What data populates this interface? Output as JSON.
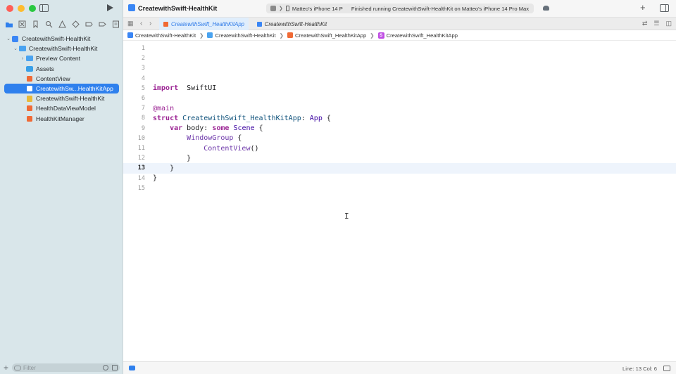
{
  "window": {
    "project_title": "CreatewithSwift-HealthKit",
    "scheme": {
      "device": "Matteo's iPhone 14 P",
      "status": "Finished running CreatewithSwift-HealthKit on Matteo's iPhone 14 Pro Max"
    },
    "add_label": "+"
  },
  "sidebar": {
    "traffic_colors": [
      "#ff5f57",
      "#febc2e",
      "#28c840"
    ],
    "nav_icons": [
      "folder-icon",
      "source-control-icon",
      "bookmark-icon",
      "find-icon",
      "issue-icon",
      "test-icon",
      "debug-icon",
      "breakpoint-icon",
      "report-icon"
    ],
    "tree": [
      {
        "label": "CreatewithSwift-HealthKit",
        "icon": "xcode-project-icon",
        "indent": 0,
        "chevron": "v"
      },
      {
        "label": "CreatewithSwift-HealthKit",
        "icon": "folder-icon",
        "indent": 1,
        "chevron": "v"
      },
      {
        "label": "Preview Content",
        "icon": "folder-icon",
        "indent": 2,
        "chevron": ">"
      },
      {
        "label": "Assets",
        "icon": "asset-catalog-icon",
        "indent": 2,
        "chevron": ""
      },
      {
        "label": "ContentView",
        "icon": "swift-file-icon",
        "indent": 2,
        "chevron": ""
      },
      {
        "label": "CreatewithSw...HealthKitApp",
        "icon": "swift-file-icon",
        "indent": 2,
        "chevron": "",
        "selected": true
      },
      {
        "label": "CreatewithSwift-HealthKit",
        "icon": "entitlements-icon",
        "indent": 2,
        "chevron": ""
      },
      {
        "label": "HealthDataViewModel",
        "icon": "swift-file-icon",
        "indent": 2,
        "chevron": ""
      },
      {
        "label": "HealthKitManager",
        "icon": "swift-file-icon",
        "indent": 2,
        "chevron": ""
      }
    ],
    "filter_placeholder": "Filter",
    "add_label": "+"
  },
  "tabs": [
    {
      "label": "CreatewithSwift_HealthKitApp",
      "active": true
    },
    {
      "label": "CreatewithSwift-HealthKit",
      "active": false
    }
  ],
  "breadcrumb": [
    "CreatewithSwift-HealthKit",
    "CreatewithSwift-HealthKit",
    "CreatewithSwift_HealthKitApp",
    "CreatewithSwift_HealthKitApp"
  ],
  "breadcrumb_badge": "S",
  "editor": {
    "current_line": 13,
    "lines": [
      {
        "n": "1",
        "tokens": []
      },
      {
        "n": "2",
        "tokens": []
      },
      {
        "n": "3",
        "tokens": []
      },
      {
        "n": "4",
        "tokens": []
      },
      {
        "n": "5",
        "tokens": [
          [
            "kw",
            "import"
          ],
          [
            "",
            "  SwiftUI"
          ]
        ]
      },
      {
        "n": "6",
        "tokens": []
      },
      {
        "n": "7",
        "tokens": [
          [
            "attr",
            "@main"
          ]
        ]
      },
      {
        "n": "8",
        "tokens": [
          [
            "kw",
            "struct"
          ],
          [
            "",
            " "
          ],
          [
            "tyd",
            "CreatewithSwift_HealthKitApp"
          ],
          [
            "",
            ": "
          ],
          [
            "ty",
            "App"
          ],
          [
            "",
            " {"
          ]
        ]
      },
      {
        "n": "9",
        "tokens": [
          [
            "",
            "    "
          ],
          [
            "kw",
            "var"
          ],
          [
            "",
            " body: "
          ],
          [
            "kw",
            "some"
          ],
          [
            "",
            " "
          ],
          [
            "ty",
            "Scene"
          ],
          [
            "",
            " {"
          ]
        ]
      },
      {
        "n": "10",
        "tokens": [
          [
            "",
            "        "
          ],
          [
            "fn",
            "WindowGroup"
          ],
          [
            "",
            " {"
          ]
        ]
      },
      {
        "n": "11",
        "tokens": [
          [
            "",
            "            "
          ],
          [
            "fn",
            "ContentView"
          ],
          [
            "",
            "()"
          ]
        ]
      },
      {
        "n": "12",
        "tokens": [
          [
            "",
            "        }"
          ]
        ]
      },
      {
        "n": "13",
        "tokens": [
          [
            "",
            "    }"
          ]
        ]
      },
      {
        "n": "14",
        "tokens": [
          [
            "",
            "}"
          ]
        ]
      },
      {
        "n": "15",
        "tokens": []
      }
    ]
  },
  "status": {
    "cursor_position": "Line: 13  Col: 6"
  }
}
